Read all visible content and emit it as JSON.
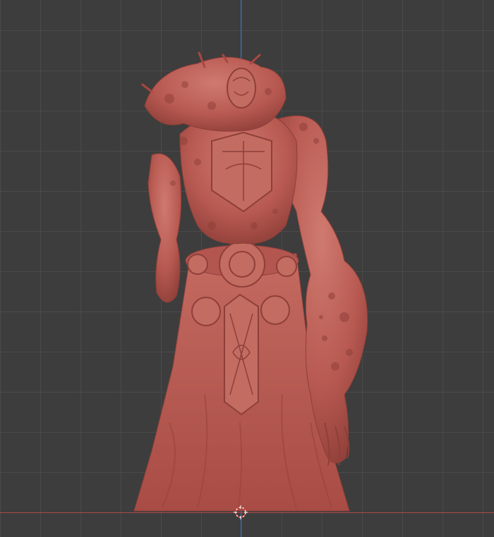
{
  "viewport": {
    "view": "front",
    "grid": true,
    "colors": {
      "background": "#3d3d3d",
      "grid_line": "#4a4a4a",
      "axis_x": "#b04a4a",
      "axis_z": "#3e6fb4",
      "sculpt_base": "#b85a52",
      "sculpt_shadow": "#8f3f39",
      "sculpt_highlight": "#d4847a"
    },
    "icons": {
      "cursor": "3d-cursor-icon"
    }
  }
}
